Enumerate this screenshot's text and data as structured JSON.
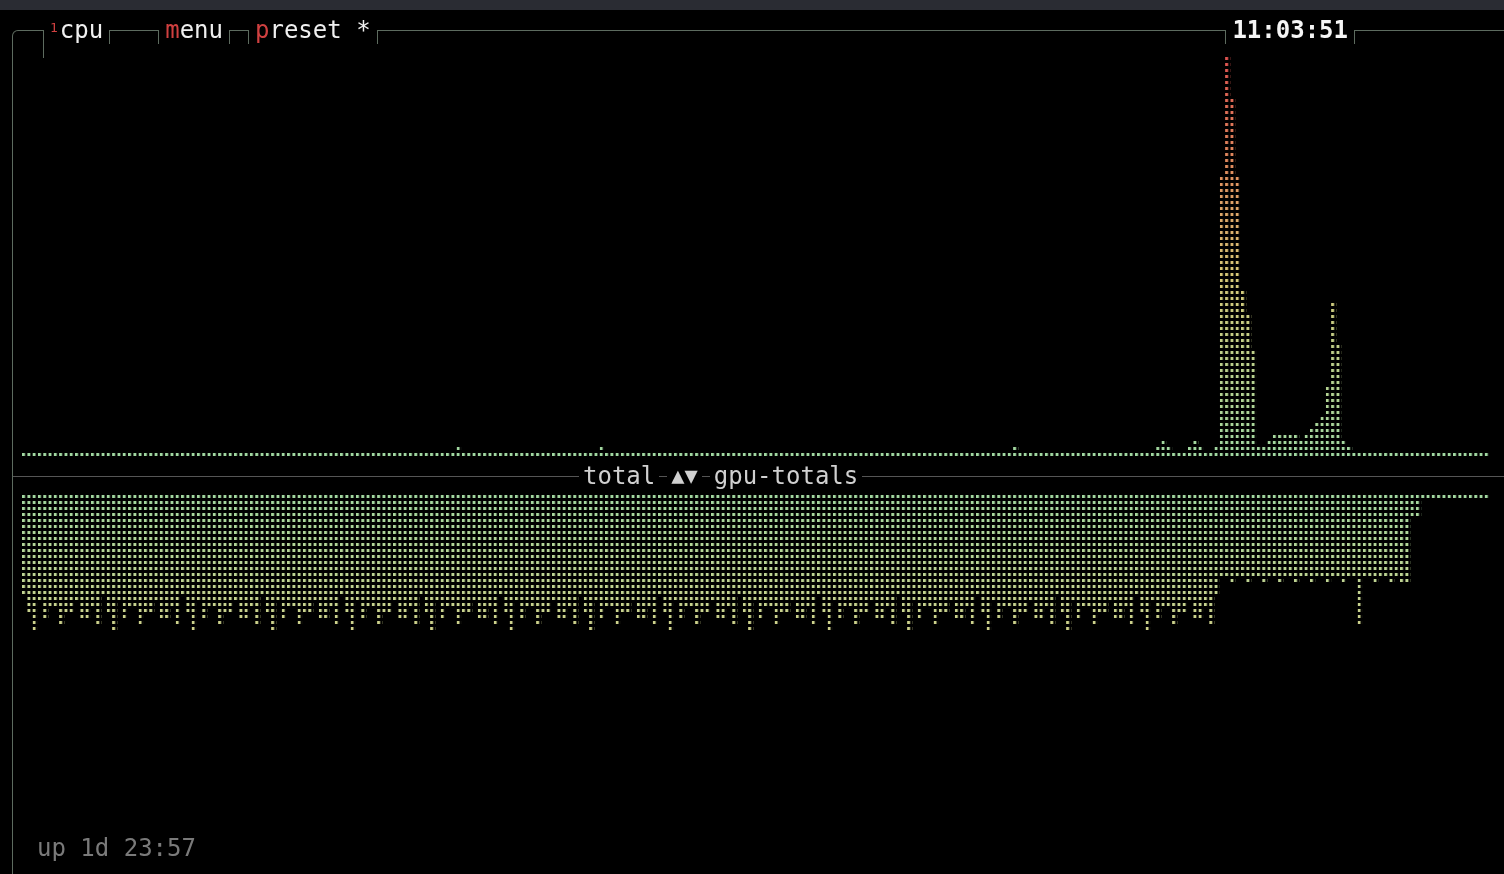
{
  "header": {
    "tabs": [
      {
        "superscript": "1",
        "label": "cpu"
      },
      {
        "hotkey": "m",
        "label": "enu"
      },
      {
        "hotkey": "p",
        "label": "reset *"
      }
    ],
    "clock": "11:03:51"
  },
  "graph_divider": {
    "upper_label": "total",
    "arrows": "▲▼",
    "lower_label": "gpu-totals"
  },
  "uptime": "up 1d 23:57"
}
